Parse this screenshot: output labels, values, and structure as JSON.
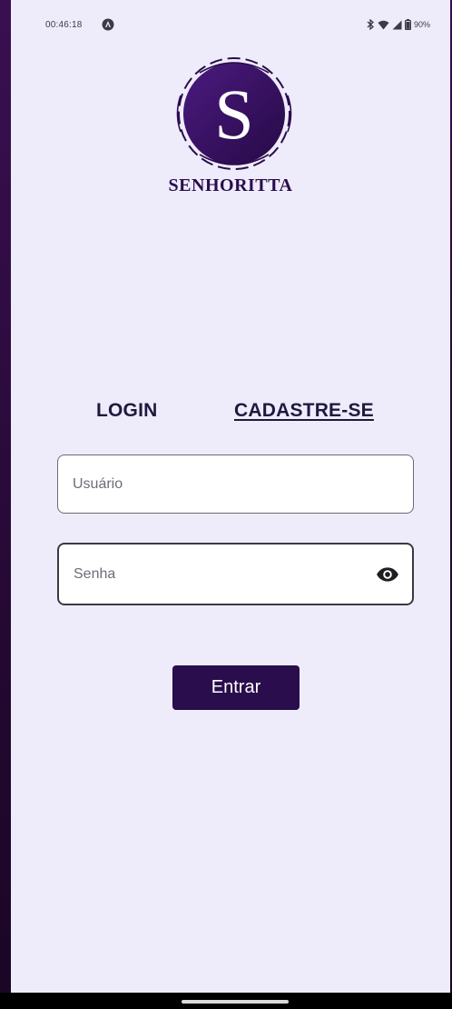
{
  "status_bar": {
    "time": "00:46:18",
    "battery": "90%"
  },
  "brand": {
    "logo_letter": "S",
    "name": "SENHORITTA",
    "color": "#2a0d4c"
  },
  "tabs": {
    "login": "LOGIN",
    "register": "CADASTRE-SE"
  },
  "form": {
    "username_placeholder": "Usuário",
    "password_placeholder": "Senha",
    "submit_label": "Entrar"
  },
  "icons": {
    "status_app": "app-indicator-icon",
    "bluetooth": "bluetooth-icon",
    "wifi": "wifi-icon",
    "signal": "signal-icon",
    "battery": "battery-icon",
    "password_toggle": "eye-icon"
  },
  "colors": {
    "background": "#eeecfb",
    "accent": "#2a0d4c",
    "frame": "#2b0a3d"
  }
}
